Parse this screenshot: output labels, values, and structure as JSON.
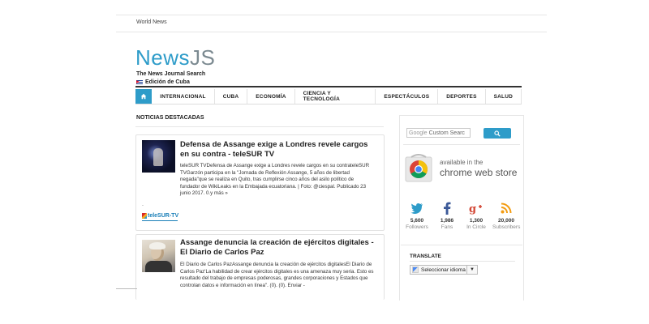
{
  "topbar": {
    "link": "World News"
  },
  "brand": {
    "logo_main": "News",
    "logo_accent": "JS",
    "tagline": "The News Journal Search",
    "edition": "Edición de Cuba",
    "colors": {
      "accent": "#2e9cc9",
      "accent_gray": "#7c8a91"
    }
  },
  "nav": {
    "home_icon": "home-icon",
    "items": [
      "INTERNACIONAL",
      "CUBA",
      "ECONOMÍA",
      "CIENCIA Y TECNOLOGÍA",
      "ESPECTÁCULOS",
      "DEPORTES",
      "SALUD"
    ]
  },
  "main": {
    "section_title": "NOTICIAS DESTACADAS",
    "articles": [
      {
        "title": "Defensa de Assange exige a Londres revele cargos en su contra - teleSUR TV",
        "excerpt": "teleSUR TVDefensa de Assange exige a Londres revele cargos en su contrateleSUR TVGarzón participa en la \"Jornada de Reflexión Assange, 5 años de libertad negada\"que se realiza en Quito, tras cumplirse cinco años del asilo político de fundador de WikiLeaks en la Embajada ecuatoriana. | Foto: @ciespal. Publicado 23 junio 2017. 0.y más »",
        "dot": ".",
        "source": "teleSUR-TV"
      },
      {
        "title": "Assange denuncia la creación de ejércitos digitales - El Diario de Carlos Paz",
        "excerpt": "El Diario de Carlos PazAssange denuncia la creación de ejércitos digitalesEl Diario de Carlos Paz'La habilidad de crear ejércitos digitales es una amenaza muy seria. Esto es resultado del trabajo de empresas poderosas, grandes corporaciones y Estados que controlan datos e información en línea\". (0). (0). Enviar -"
      }
    ]
  },
  "sidebar": {
    "search": {
      "prefix": "Google",
      "placeholder": "Custom Searc",
      "button_icon": "search-icon"
    },
    "chrome_store": {
      "line1": "available in the",
      "line2": "chrome web store"
    },
    "social": [
      {
        "icon": "twitter-icon",
        "count": "5,600",
        "label": "Followers",
        "color": "#2e9cc9"
      },
      {
        "icon": "facebook-icon",
        "count": "1,986",
        "label": "Fans",
        "color": "#3b5998"
      },
      {
        "icon": "google-plus-icon",
        "count": "1,300",
        "label": "In Circle",
        "color": "#d34836"
      },
      {
        "icon": "rss-icon",
        "count": "20,000",
        "label": "Subscribers",
        "color": "#f39c12"
      }
    ],
    "translate": {
      "title": "TRANSLATE",
      "select_value": "Seleccionar idioma",
      "arrow": "▼"
    }
  }
}
